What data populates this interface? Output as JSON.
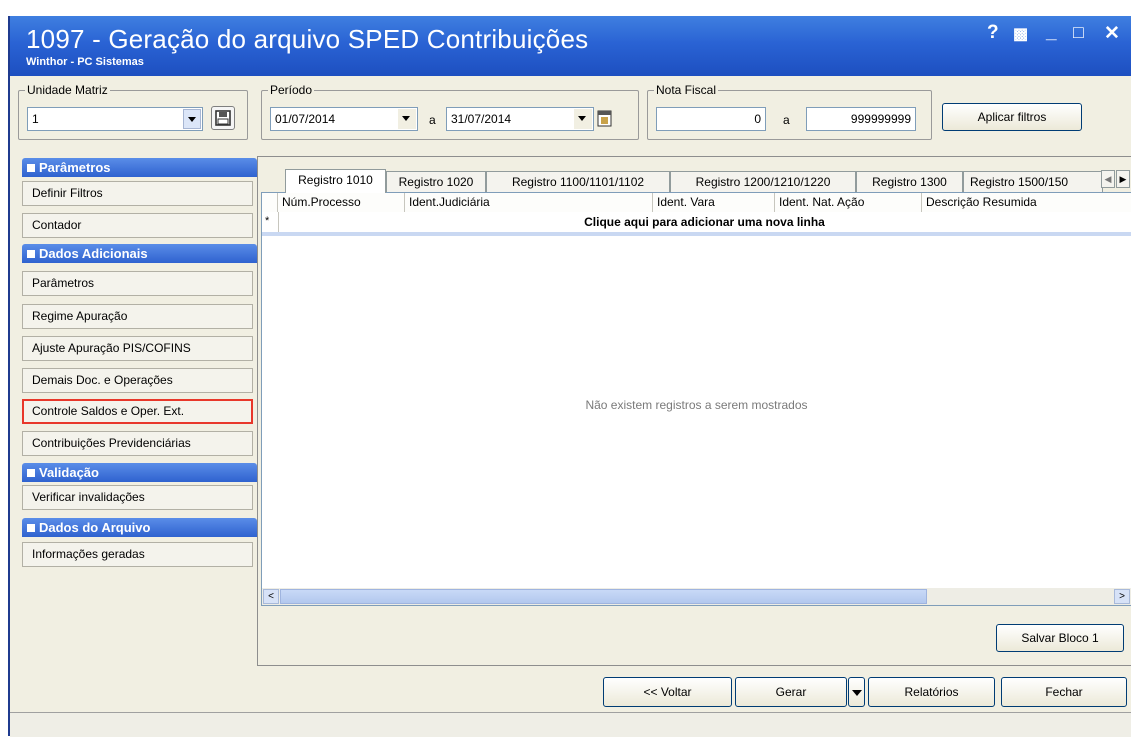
{
  "window": {
    "title": "1097 - Geração do arquivo SPED Contribuições",
    "subtitle": "Winthor - PC Sistemas",
    "controls": {
      "help": "?",
      "restore": "▩",
      "minimize": "_",
      "maximize": "□",
      "close": "✕"
    }
  },
  "filters": {
    "unidade_matriz": {
      "label": "Unidade Matriz",
      "value": "1"
    },
    "periodo": {
      "label": "Período",
      "from": "01/07/2014",
      "separator": "a",
      "to": "31/07/2014"
    },
    "nota_fiscal": {
      "label": "Nota Fiscal",
      "from": "0",
      "separator": "a",
      "to": "999999999"
    },
    "apply_button": "Aplicar filtros"
  },
  "sidebar": {
    "sections": [
      {
        "title": "Parâmetros",
        "items": [
          "Definir Filtros",
          "Contador"
        ]
      },
      {
        "title": "Dados Adicionais",
        "items": [
          "Parâmetros",
          "Regime Apuração",
          "Ajuste Apuração PIS/COFINS",
          "Demais Doc. e Operações",
          "Controle Saldos e Oper. Ext.",
          "Contribuições Previdenciárias"
        ]
      },
      {
        "title": "Validação",
        "items": [
          "Verificar invalidações"
        ]
      },
      {
        "title": "Dados do Arquivo",
        "items": [
          "Informações geradas"
        ]
      }
    ],
    "selected_item": "Controle Saldos e Oper. Ext."
  },
  "tabs": [
    "Registro 1010",
    "Registro 1020",
    "Registro 1100/1101/1102",
    "Registro 1200/1210/1220",
    "Registro 1300",
    "Registro 1500/150"
  ],
  "active_tab": "Registro 1010",
  "grid": {
    "columns": [
      "Núm.Processo",
      "Ident.Judiciária",
      "Ident. Vara",
      "Ident. Nat. Ação",
      "Descrição Resumida"
    ],
    "new_row_marker": "*",
    "new_row_text": "Clique aqui para adicionar uma nova linha",
    "empty_text": "Não existem registros a serem mostrados"
  },
  "buttons": {
    "salvar_bloco": "Salvar Bloco 1",
    "voltar": "<< Voltar",
    "gerar": "Gerar",
    "relatorios": "Relatórios",
    "fechar": "Fechar"
  },
  "colors": {
    "title_bar": "#2a63d4",
    "section_header": "#3b6fd8",
    "selected_border": "#e8372a",
    "window_bg": "#f1efe2"
  }
}
